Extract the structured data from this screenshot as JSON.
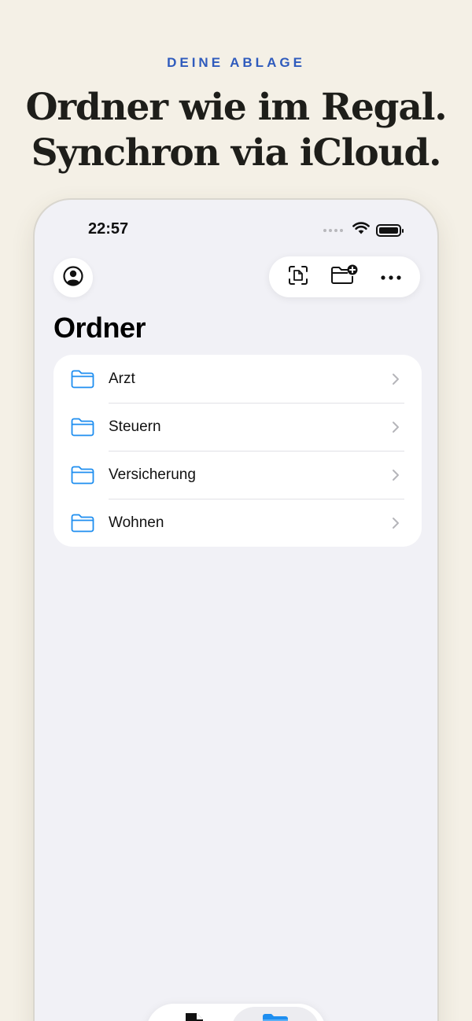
{
  "marketing": {
    "eyebrow": "DEINE ABLAGE",
    "headline_line1": "Ordner wie im Regal.",
    "headline_line2": "Synchron via iCloud."
  },
  "status_bar": {
    "time": "22:57"
  },
  "nav": {
    "profile_icon": "person-circle-icon",
    "toolbar_icons": [
      "scan-document-icon",
      "new-folder-icon",
      "more-icon"
    ]
  },
  "page": {
    "title": "Ordner"
  },
  "folders": [
    {
      "label": "Arzt"
    },
    {
      "label": "Steuern"
    },
    {
      "label": "Versicherung"
    },
    {
      "label": "Wohnen"
    }
  ],
  "tab_bar": {
    "tabs": [
      "documents-icon",
      "folders-icon"
    ],
    "selected": "folders"
  },
  "colors": {
    "background": "#f4f0e6",
    "accent": "#2f5bbd",
    "folder_icon": "#1e8ef0",
    "screen_bg": "#f1f1f6"
  }
}
